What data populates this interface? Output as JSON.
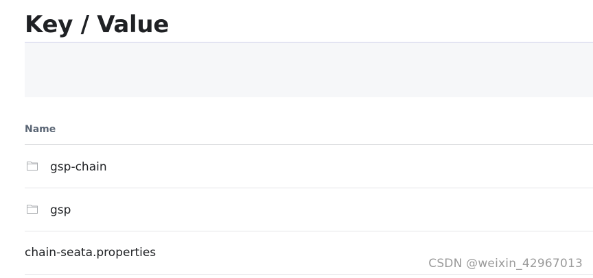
{
  "page": {
    "title": "Key / Value"
  },
  "table": {
    "columns": [
      {
        "label": "Name"
      }
    ],
    "rows": [
      {
        "name": "gsp-chain",
        "type": "folder",
        "icon": "folder-icon"
      },
      {
        "name": "gsp",
        "type": "folder",
        "icon": "folder-icon"
      },
      {
        "name": "chain-seata.properties",
        "type": "key"
      }
    ]
  },
  "watermark": {
    "text": "CSDN @weixin_42967013"
  },
  "colors": {
    "title": "#1f2124",
    "header_text": "#5b6675",
    "toolbar_band": "#f6f7f9",
    "divider": "#e3e4e6"
  }
}
